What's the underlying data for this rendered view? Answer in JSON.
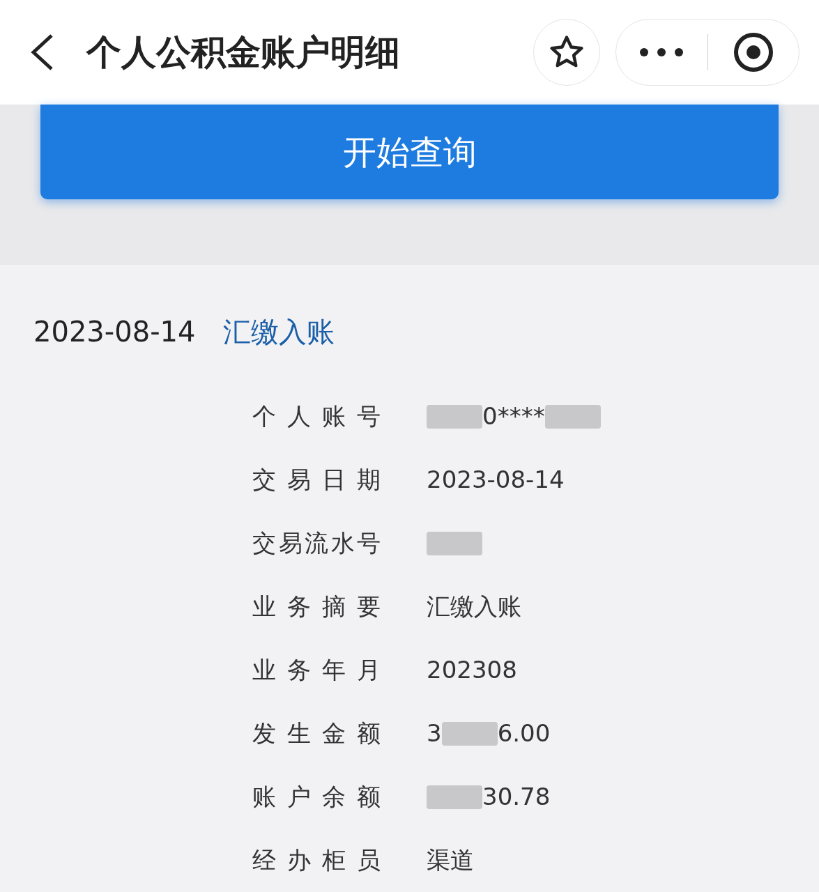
{
  "header": {
    "title": "个人公积金账户明细"
  },
  "query_button": {
    "label": "开始查询"
  },
  "record": {
    "date": "2023-08-14",
    "type": "汇缴入账",
    "details": [
      {
        "label": "个人账号",
        "value": [
          {
            "kind": "blur"
          },
          {
            "kind": "text",
            "text": "0****"
          },
          {
            "kind": "blur"
          }
        ]
      },
      {
        "label": "交易日期",
        "value": [
          {
            "kind": "text",
            "text": "2023-08-14"
          }
        ]
      },
      {
        "label": "交易流水号",
        "value": [
          {
            "kind": "blur"
          }
        ]
      },
      {
        "label": "业务摘要",
        "value": [
          {
            "kind": "text",
            "text": "汇缴入账"
          }
        ]
      },
      {
        "label": "业务年月",
        "value": [
          {
            "kind": "text",
            "text": "202308"
          }
        ]
      },
      {
        "label": "发生金额",
        "value": [
          {
            "kind": "text",
            "text": "3"
          },
          {
            "kind": "blur"
          },
          {
            "kind": "text",
            "text": "6.00"
          }
        ]
      },
      {
        "label": "账户余额",
        "value": [
          {
            "kind": "blur"
          },
          {
            "kind": "text",
            "text": "30.78"
          }
        ]
      },
      {
        "label": "经办柜员",
        "value": [
          {
            "kind": "text",
            "text": "渠道"
          }
        ]
      }
    ]
  }
}
